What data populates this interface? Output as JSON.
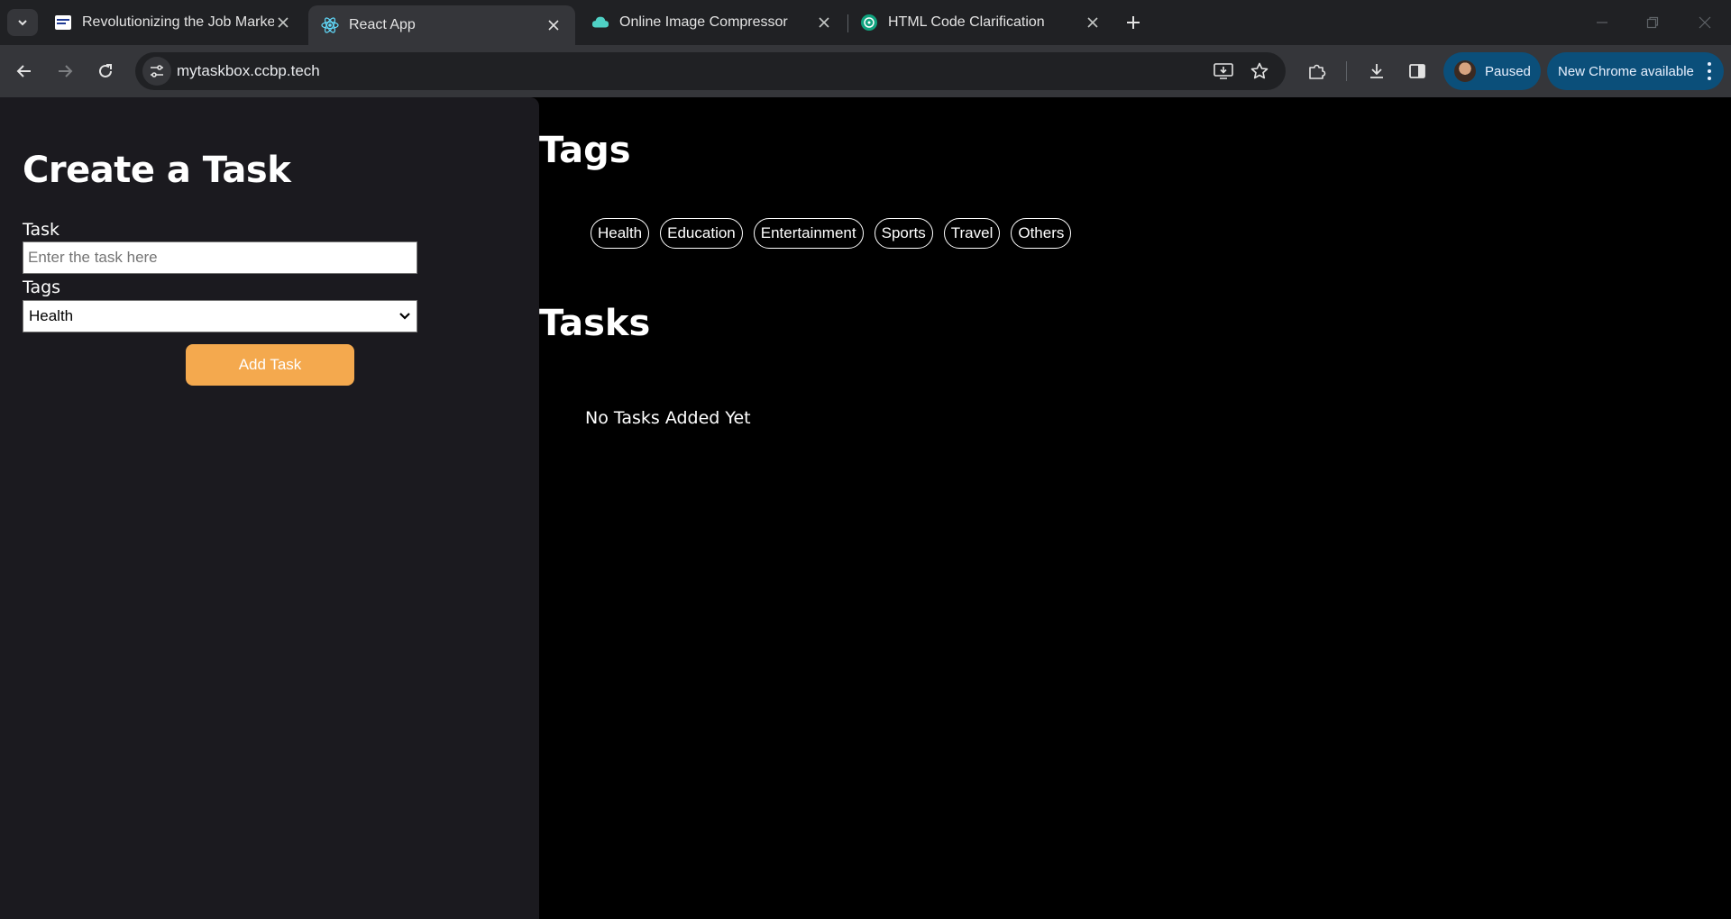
{
  "browser": {
    "tabs": [
      {
        "title": "Revolutionizing the Job Market",
        "favicon": "nxt-wave-favicon"
      },
      {
        "title": "React App",
        "favicon": "react-icon"
      },
      {
        "title": "Online Image Compressor",
        "favicon": "cloud-icon"
      },
      {
        "title": "HTML Code Clarification",
        "favicon": "chatgpt-icon"
      }
    ],
    "url": "mytaskbox.ccbp.tech",
    "profile_label": "Paused",
    "update_label": "New Chrome available"
  },
  "form": {
    "heading": "Create a Task",
    "task_label": "Task",
    "task_placeholder": "Enter the task here",
    "task_value": "",
    "tags_label": "Tags",
    "tags_selected": "Health",
    "add_button": "Add Task"
  },
  "tags_section": {
    "heading": "Tags",
    "tags": [
      "Health",
      "Education",
      "Entertainment",
      "Sports",
      "Travel",
      "Others"
    ]
  },
  "tasks_section": {
    "heading": "Tasks",
    "empty_message": "No Tasks Added Yet"
  },
  "colors": {
    "accent_button": "#f4a94e",
    "left_panel_bg": "#1b1a1f",
    "page_bg": "#000000"
  }
}
